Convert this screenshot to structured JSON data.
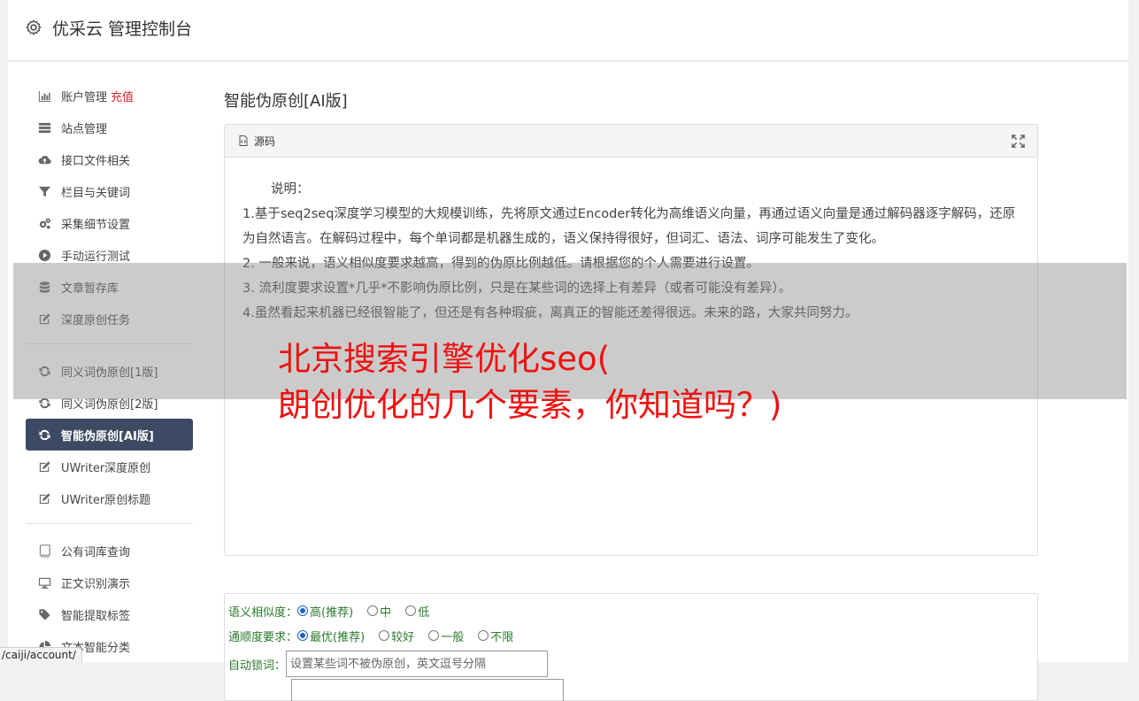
{
  "header": {
    "title": "优采云 管理控制台"
  },
  "sidebar": {
    "group1": [
      {
        "label": "账户管理",
        "badge": "充值",
        "icon": "bar-chart-icon"
      },
      {
        "label": "站点管理",
        "icon": "server-icon"
      },
      {
        "label": "接口文件相关",
        "icon": "cloud-upload-icon"
      },
      {
        "label": "栏目与关键词",
        "icon": "filter-icon"
      },
      {
        "label": "采集细节设置",
        "icon": "gears-icon"
      },
      {
        "label": "手动运行测试",
        "icon": "play-icon"
      },
      {
        "label": "文章暂存库",
        "icon": "database-icon"
      },
      {
        "label": "深度原创任务",
        "icon": "edit-icon"
      }
    ],
    "group2": [
      {
        "label": "同义词伪原创[1版]",
        "icon": "refresh-icon"
      },
      {
        "label": "同义词伪原创[2版]",
        "icon": "refresh-icon"
      },
      {
        "label": "智能伪原创[AI版]",
        "icon": "refresh-icon"
      },
      {
        "label": "UWriter深度原创",
        "icon": "edit-icon"
      },
      {
        "label": "UWriter原创标题",
        "icon": "edit-icon"
      }
    ],
    "group3": [
      {
        "label": "公有词库查询",
        "icon": "book-icon"
      },
      {
        "label": "正文识别演示",
        "icon": "desktop-icon"
      },
      {
        "label": "智能提取标签",
        "icon": "tag-icon"
      },
      {
        "label": "文本智能分类",
        "icon": "pie-chart-icon"
      }
    ]
  },
  "main": {
    "page_title": "智能伪原创[AI版]",
    "editor": {
      "source_label": "源码",
      "intro": "说明：",
      "lines": [
        "1.基于seq2seq深度学习模型的大规模训练，先将原文通过Encoder转化为高维语义向量，再通过语义向量是通过解码器逐字解码，还原为自然语言。在解码过程中，每个单词都是机器生成的，语义保持得很好，但词汇、语法、词序可能发生了变化。",
        "2. 一般来说，语义相似度要求越高，得到的伪原比例越低。请根据您的个人需要进行设置。",
        "3. 流利度要求设置*几乎*不影响伪原比例，只是在某些词的选择上有差异（或者可能没有差异）。",
        "4.虽然看起来机器已经很智能了，但还是有各种瑕疵，离真正的智能还差得很远。未来的路，大家共同努力。"
      ]
    },
    "options": {
      "similarity_label": "语义相似度：",
      "similarity_choices": [
        "高(推荐)",
        "中",
        "低"
      ],
      "fluency_label": "通顺度要求：",
      "fluency_choices": [
        "最优(推荐)",
        "较好",
        "一般",
        "不限"
      ],
      "lock_label": "自动锁词：",
      "lock_placeholder": "设置某些词不被伪原创，英文逗号分隔"
    }
  },
  "overlay": {
    "line1": "北京搜索引擎优化seo(",
    "line2": "朗创优化的几个要素，你知道吗？)"
  },
  "statusbar": {
    "url": "/caiji/account/"
  }
}
